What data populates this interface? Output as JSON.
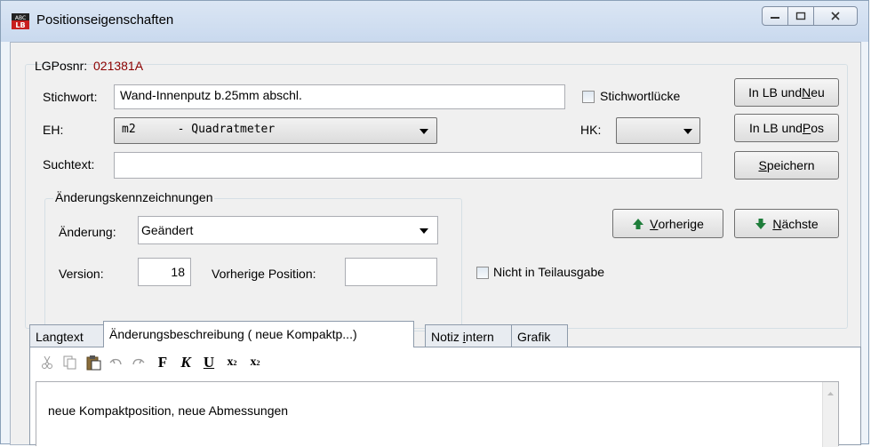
{
  "window": {
    "title": "Positionseigenschaften",
    "icon": "lb-app-icon",
    "controls": [
      "minimize-icon",
      "maximize-icon",
      "close-icon"
    ]
  },
  "form": {
    "lgposnr_label": "LGPosnr:",
    "lgposnr_value": "021381A",
    "stichwort_label": "Stichwort:",
    "stichwort_value": "Wand-Innenputz b.25mm abschl.",
    "stichwortluecke_label": "Stichwortlücke",
    "eh_label": "EH:",
    "eh_value": "m2      - Quadratmeter",
    "hk_label": "HK:",
    "hk_value": "",
    "suchtext_label": "Suchtext:",
    "suchtext_value": ""
  },
  "changes": {
    "group_label": "Änderungskennzeichnungen",
    "aenderung_label": "Änderung:",
    "aenderung_value": "Geändert",
    "version_label": "Version:",
    "version_value": "18",
    "vorherige_position_label": "Vorherige Position:",
    "vorherige_position_value": "",
    "nicht_in_teilausgabe_label": "Nicht in Teilausgabe"
  },
  "buttons": {
    "in_lb_und_neu_a": "In LB und ",
    "in_lb_und_neu_b": "N",
    "in_lb_und_neu_c": "eu",
    "in_lb_und_pos_a": "In LB und ",
    "in_lb_und_pos_b": "P",
    "in_lb_und_pos_c": "os",
    "speichern_a": "S",
    "speichern_b": "peichern",
    "vorherige_a": "V",
    "vorherige_b": "orherige",
    "naechste_a": "N",
    "naechste_b": "ächste"
  },
  "tabs": [
    {
      "label": "Langtext"
    },
    {
      "label": "Änderungsbeschreibung ( neue Kompaktp...)"
    },
    {
      "label_a": "Notiz ",
      "label_b": "i",
      "label_c": "ntern"
    },
    {
      "label": "Grafik"
    }
  ],
  "toolbar": {
    "icons": [
      "cut-icon",
      "copy-icon",
      "paste-icon",
      "undo-icon",
      "redo-icon",
      "bold-icon",
      "italic-icon",
      "underline-icon",
      "subscript-icon",
      "superscript-icon"
    ],
    "bold_glyph": "F",
    "italic_glyph": "K",
    "underline_glyph": "U",
    "sub_glyph": "x",
    "sub_index": "2",
    "sup_glyph": "x",
    "sup_index": "2"
  },
  "editor": {
    "text": "neue Kompaktposition, neue Abmessungen"
  },
  "colors": {
    "lgposnr_value": "#8b0000",
    "arrow_green": "#1e7d3a"
  }
}
